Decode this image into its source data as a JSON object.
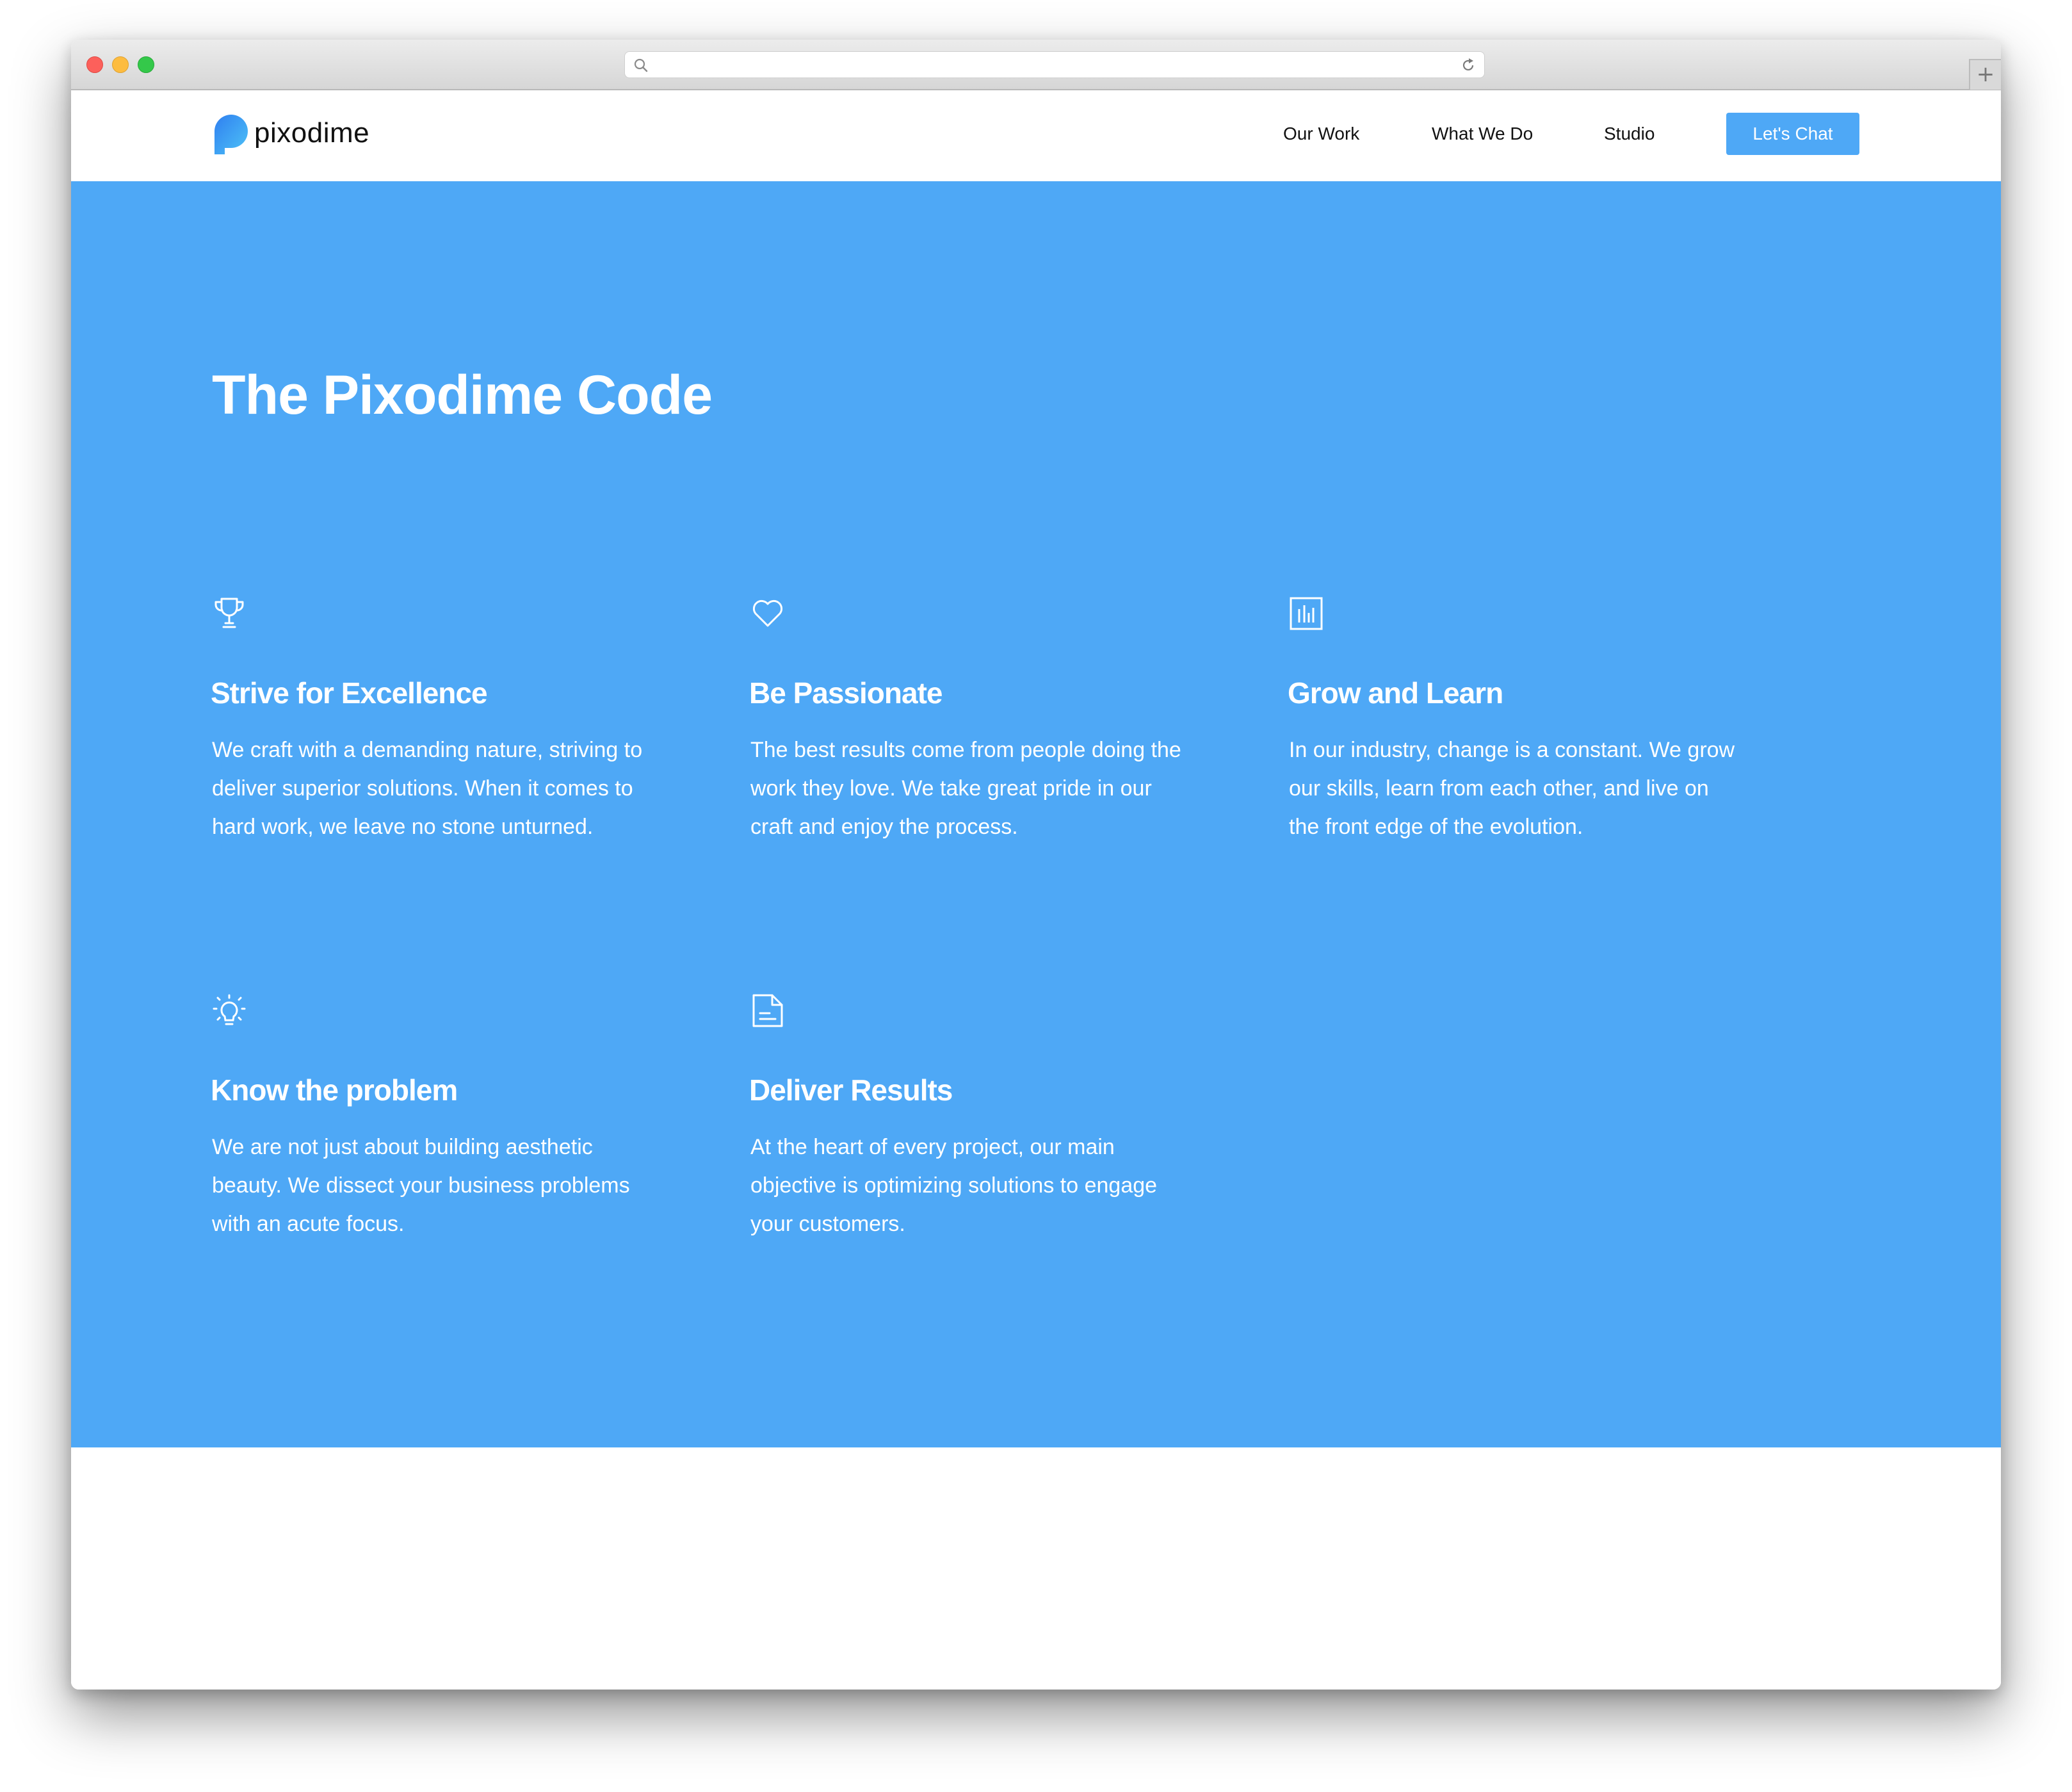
{
  "site": {
    "logo_text": "pixodime",
    "nav": [
      "Our Work",
      "What We Do",
      "Studio"
    ],
    "cta_label": "Let's Chat"
  },
  "hero": {
    "title": "The Pixodime Code",
    "cards": [
      {
        "icon": "trophy-icon",
        "title": "Strive for Excellence",
        "text": "We craft with a demanding nature, striving to deliver superior solutions. When it comes to hard work, we leave no stone unturned."
      },
      {
        "icon": "heart-icon",
        "title": "Be Passionate",
        "text": "The best results come from people doing the work they love. We take great pride in our craft and enjoy the process."
      },
      {
        "icon": "bar-chart-icon",
        "title": "Grow and Learn",
        "text": "In our industry, change is a constant. We grow our skills, learn from each other, and live on the front edge of the evolution."
      },
      {
        "icon": "lightbulb-icon",
        "title": "Know the problem",
        "text": "We are not just about building aesthetic beauty. We dissect your business problems with an acute focus."
      },
      {
        "icon": "document-icon",
        "title": "Deliver Results",
        "text": "At the heart of every project, our main objective is optimizing solutions to engage your customers."
      }
    ]
  },
  "colors": {
    "brand_blue": "#4ea8f6",
    "text_white": "#ffffff",
    "header_text": "#111111"
  }
}
